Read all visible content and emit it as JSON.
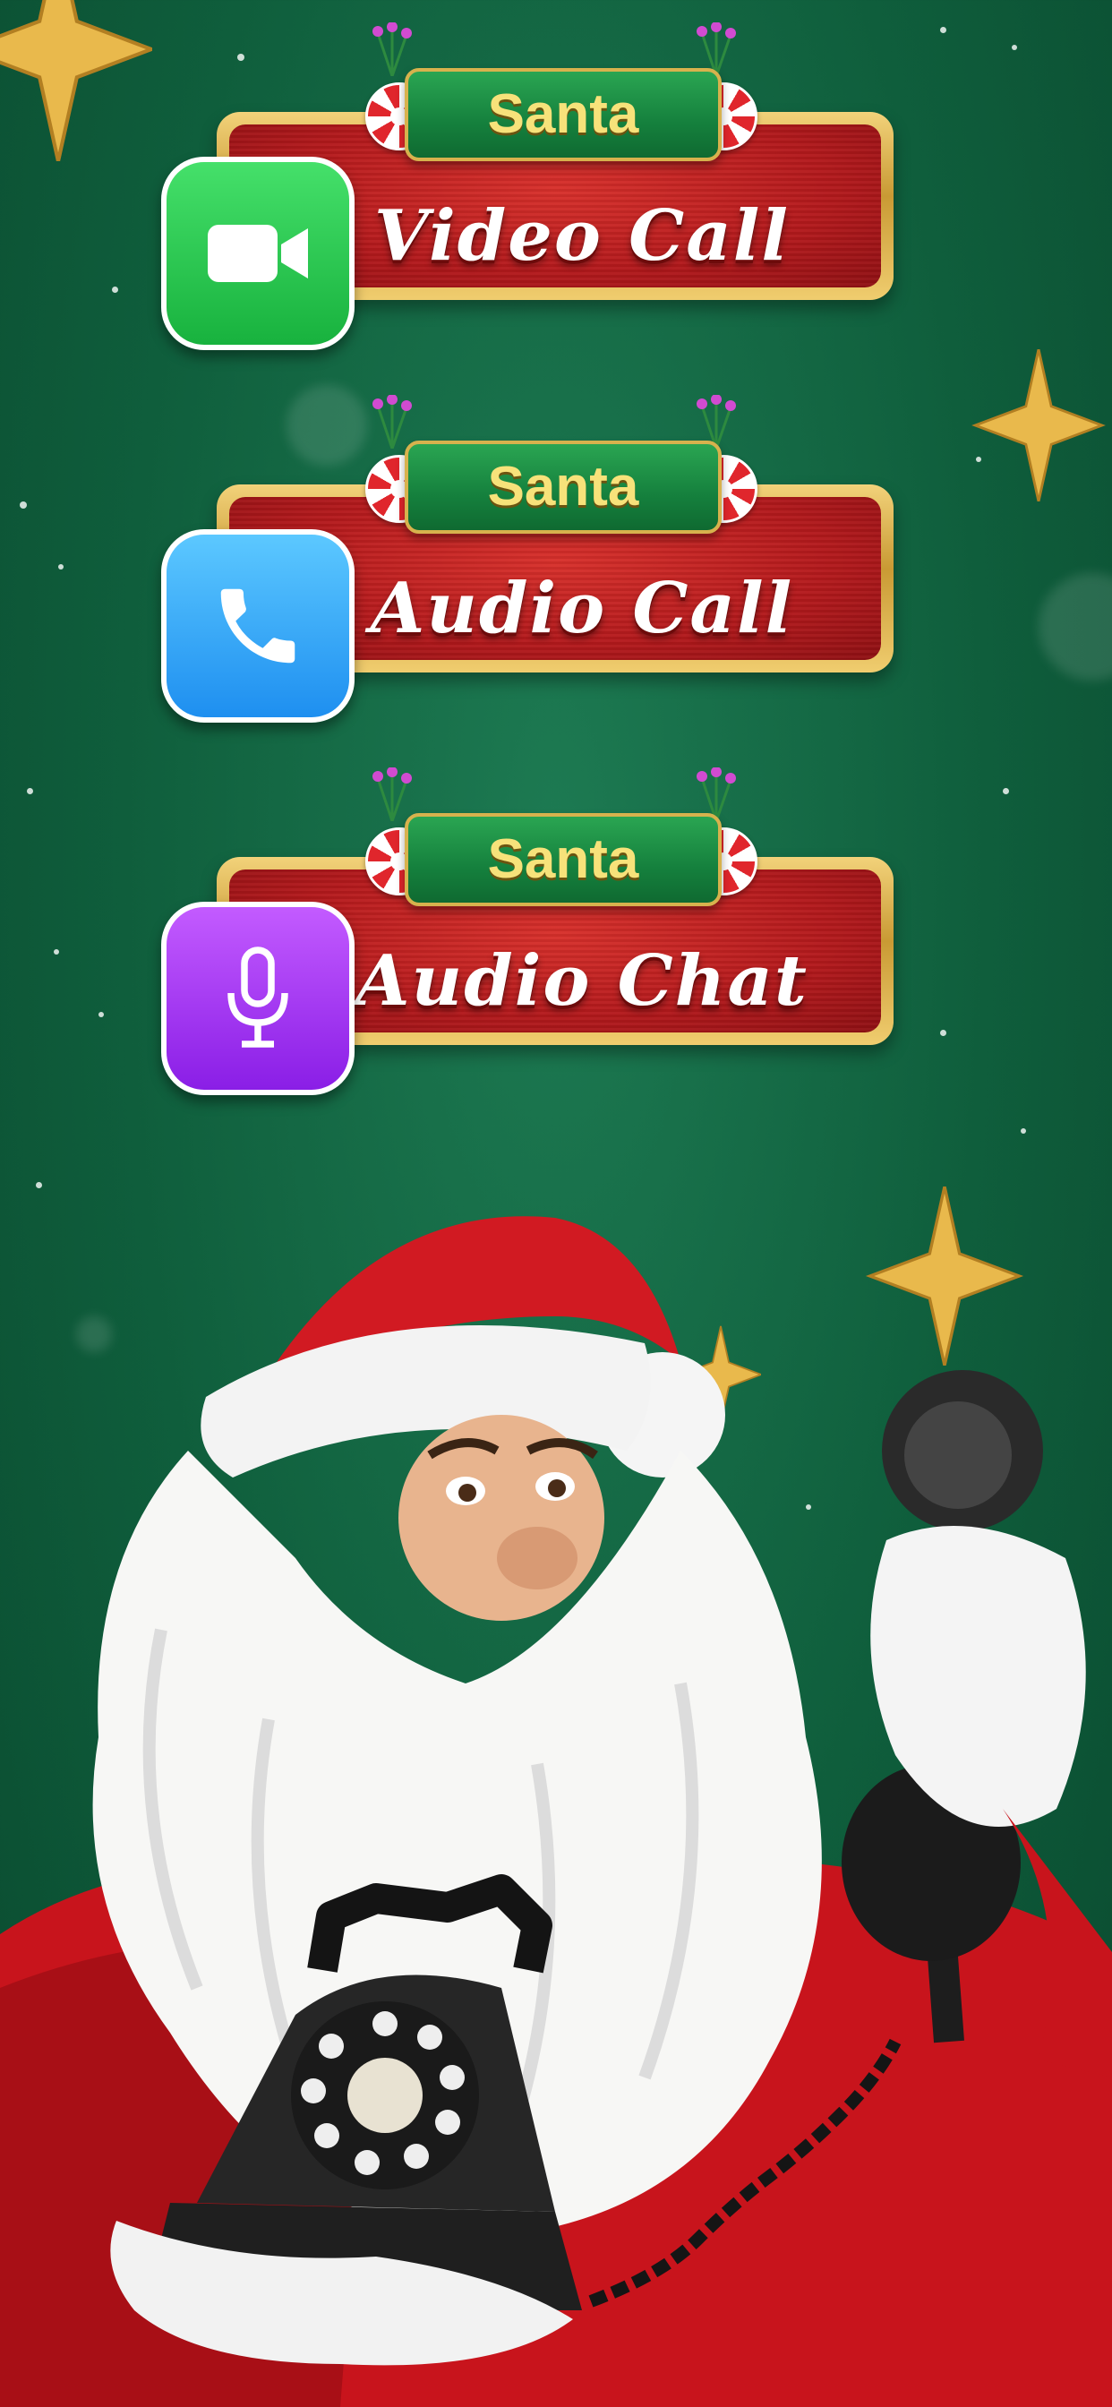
{
  "colors": {
    "background": "#0f5e3c",
    "plaque_red": "#b3191c",
    "gold": "#c99a34",
    "ribbon_green": "#15803d",
    "video_icon": "#22c55e",
    "audio_icon": "#38a8f5",
    "chat_icon": "#a335f5",
    "ribbon_text": "#f7e27a"
  },
  "buttons": [
    {
      "ribbon": "Santa",
      "label": "Video Call",
      "icon": "video-camera-icon"
    },
    {
      "ribbon": "Santa",
      "label": "Audio Call",
      "icon": "phone-icon"
    },
    {
      "ribbon": "Santa",
      "label": "Audio Chat",
      "icon": "microphone-icon"
    }
  ],
  "illustration": {
    "subject": "santa-with-telephone"
  }
}
